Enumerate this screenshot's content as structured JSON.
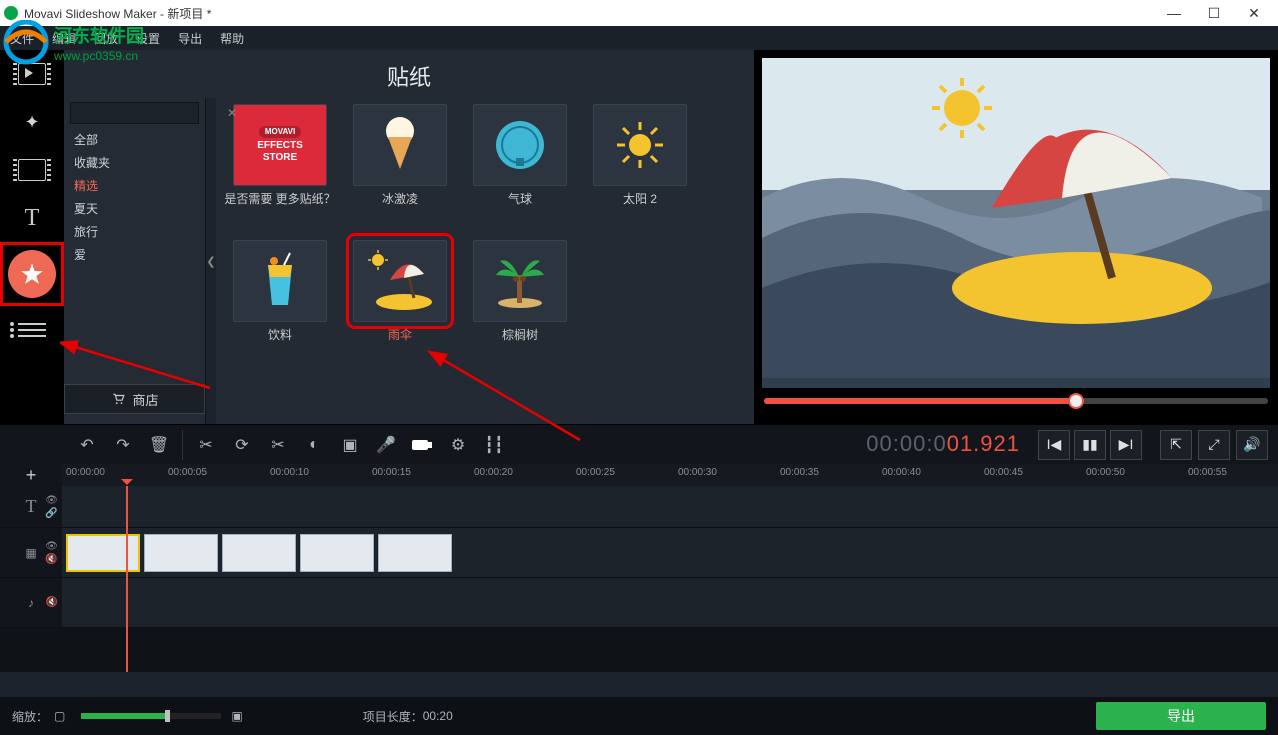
{
  "window": {
    "title": "Movavi Slideshow Maker - 新项目 *"
  },
  "menu": [
    "文件",
    "编辑",
    "回放",
    "设置",
    "导出",
    "帮助"
  ],
  "watermark": {
    "line1": "河东软件园",
    "line2": "www.pc0359.cn"
  },
  "panel": {
    "title": "贴纸",
    "search_placeholder": "",
    "categories": [
      "全部",
      "收藏夹",
      "精选",
      "夏天",
      "旅行",
      "爱"
    ],
    "active_category": "精选",
    "store_label": "商店",
    "items": [
      {
        "id": "store",
        "label": "是否需要 更多贴纸？",
        "badge_top": "MOVAVI",
        "badge_mid": "EFFECTS",
        "badge_bot": "STORE"
      },
      {
        "id": "icecream",
        "label": "冰激凌"
      },
      {
        "id": "balloon",
        "label": "气球"
      },
      {
        "id": "sun2",
        "label": "太阳 2"
      },
      {
        "id": "drink",
        "label": "饮料"
      },
      {
        "id": "umbrella",
        "label": "雨伞",
        "selected": true
      },
      {
        "id": "palm",
        "label": "棕榈树"
      }
    ]
  },
  "preview": {
    "help": "?"
  },
  "timecode_gray": "00:00:0",
  "timecode_orange": "01.921",
  "ruler_ticks": [
    "00:00:00",
    "00:00:05",
    "00:00:10",
    "00:00:15",
    "00:00:20",
    "00:00:25",
    "00:00:30",
    "00:00:35",
    "00:00:40",
    "00:00:45",
    "00:00:50",
    "00:00:55"
  ],
  "footer": {
    "zoom_label": "缩放：",
    "length_label": "项目长度：",
    "length_value": "00:20",
    "export": "导出"
  }
}
